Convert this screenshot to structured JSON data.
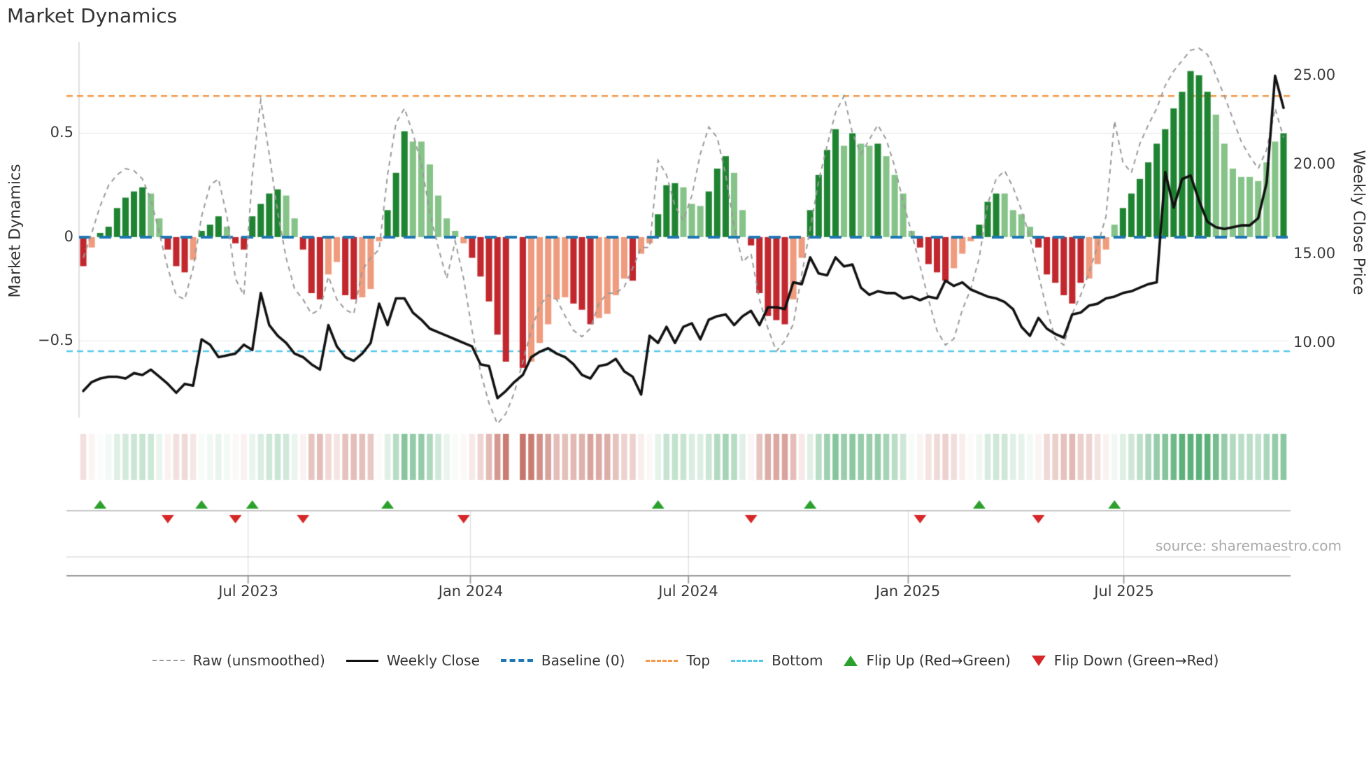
{
  "title": "Market Dynamics",
  "source_note": "source: sharemaestro.com",
  "colors": {
    "bar_positive_strong": "#1f8432",
    "bar_positive_faded": "#86c388",
    "bar_negative_strong": "#c1272d",
    "bar_negative_faded": "#ef9b7d",
    "weekly_close_line": "#111111",
    "raw_line": "#999999",
    "baseline_line": "#1f77b4",
    "top_line": "#f2994a",
    "bottom_line": "#55c8e8",
    "flip_up_marker": "#2ca02c",
    "flip_down_marker": "#d62728",
    "grid": "#e8e8e8",
    "source_text": "#aaaaaa"
  },
  "left_axis": {
    "label": "Market Dynamics",
    "range": [
      -0.87,
      0.94
    ],
    "ticks": [
      {
        "value": 0.5,
        "label": "0.5"
      },
      {
        "value": 0.0,
        "label": "0"
      },
      {
        "value": -0.5,
        "label": "−0.5"
      }
    ]
  },
  "right_axis": {
    "label": "Weekly Close Price",
    "range": [
      5.8,
      26.9
    ],
    "ticks": [
      {
        "value": 25,
        "label": "25.00"
      },
      {
        "value": 20,
        "label": "20.00"
      },
      {
        "value": 15,
        "label": "15.00"
      },
      {
        "value": 10,
        "label": "10.00"
      }
    ]
  },
  "x_axis": {
    "ticks": [
      {
        "week": 19.5,
        "label": "Jul 2023"
      },
      {
        "week": 45.8,
        "label": "Jan 2024"
      },
      {
        "week": 71.6,
        "label": "Jul 2024"
      },
      {
        "week": 97.6,
        "label": "Jan 2025"
      },
      {
        "week": 123.1,
        "label": "Jul 2025"
      }
    ]
  },
  "legend": {
    "items": [
      {
        "key": "raw",
        "label": "Raw (unsmoothed)"
      },
      {
        "key": "close",
        "label": "Weekly Close"
      },
      {
        "key": "baseline",
        "label": "Baseline (0)"
      },
      {
        "key": "top",
        "label": "Top"
      },
      {
        "key": "bottom",
        "label": "Bottom"
      },
      {
        "key": "flip_up",
        "label": "Flip Up (Red→Green)"
      },
      {
        "key": "flip_down",
        "label": "Flip Down (Green→Red)"
      }
    ]
  },
  "chart_data": {
    "type": "combo: weekly bars (market dynamics, left axis) + heatmap strip + flip event markers + lines (weekly close on right axis, raw dashed on left axis)",
    "n_weeks": 143,
    "reference_lines": {
      "baseline": 0.0,
      "top": 0.68,
      "bottom": -0.55
    },
    "bars": {
      "values": [
        -0.14,
        -0.05,
        0.02,
        0.05,
        0.14,
        0.19,
        0.22,
        0.24,
        0.21,
        0.09,
        -0.06,
        -0.14,
        -0.17,
        -0.11,
        0.03,
        0.06,
        0.1,
        0.05,
        -0.03,
        -0.06,
        0.1,
        0.16,
        0.21,
        0.23,
        0.2,
        0.09,
        -0.06,
        -0.27,
        -0.3,
        -0.18,
        -0.12,
        -0.28,
        -0.3,
        -0.29,
        -0.25,
        -0.02,
        0.13,
        0.31,
        0.51,
        0.46,
        0.46,
        0.35,
        0.2,
        0.09,
        0.03,
        -0.03,
        -0.1,
        -0.19,
        -0.31,
        -0.47,
        -0.6,
        0.0,
        -0.63,
        -0.6,
        -0.51,
        -0.42,
        -0.3,
        -0.29,
        -0.32,
        -0.35,
        -0.42,
        -0.39,
        -0.37,
        -0.28,
        -0.2,
        -0.21,
        -0.08,
        -0.03,
        0.11,
        0.25,
        0.26,
        0.24,
        0.16,
        0.15,
        0.22,
        0.33,
        0.39,
        0.31,
        0.13,
        -0.04,
        -0.27,
        -0.38,
        -0.4,
        -0.42,
        -0.3,
        -0.1,
        0.13,
        0.3,
        0.42,
        0.52,
        0.44,
        0.5,
        0.45,
        0.44,
        0.45,
        0.39,
        0.3,
        0.21,
        0.03,
        -0.05,
        -0.13,
        -0.17,
        -0.21,
        -0.15,
        -0.08,
        -0.02,
        0.06,
        0.17,
        0.21,
        0.21,
        0.13,
        0.11,
        0.05,
        -0.05,
        -0.18,
        -0.22,
        -0.28,
        -0.32,
        -0.22,
        -0.2,
        -0.13,
        -0.06,
        0.06,
        0.14,
        0.21,
        0.28,
        0.36,
        0.45,
        0.52,
        0.62,
        0.7,
        0.8,
        0.78,
        0.7,
        0.59,
        0.45,
        0.33,
        0.29,
        0.29,
        0.27,
        0.36,
        0.46,
        0.5
      ],
      "shades": "dlddddddlldddldddldvar_placeholder",
      "shade_string": "dlddddddlldddldddldqddddlldddllddllldddlllllllddddd0dllllldddlllldlldddllldddlldddddllddddldlldllllddddllldddllllddddddlllldddddddddddllllllllddd",
      "shade_legend": "d = strong/dark bar (momentum increasing), l = faded/light bar (momentum fading), 0 = no bar (zero week)"
    },
    "weekly_close": [
      7.3,
      7.8,
      8.0,
      8.1,
      8.1,
      8.0,
      8.3,
      8.2,
      8.5,
      8.1,
      7.7,
      7.2,
      7.7,
      7.6,
      10.2,
      9.9,
      9.2,
      9.3,
      9.4,
      9.9,
      9.6,
      12.8,
      11.0,
      10.4,
      10.0,
      9.4,
      9.2,
      8.8,
      8.5,
      11.0,
      9.8,
      9.2,
      9.0,
      9.4,
      10.0,
      12.2,
      11.0,
      12.5,
      12.5,
      11.7,
      11.3,
      10.8,
      10.6,
      10.4,
      10.2,
      10.0,
      9.8,
      8.8,
      8.7,
      6.9,
      7.3,
      7.8,
      8.2,
      9.2,
      9.5,
      9.7,
      9.4,
      9.2,
      8.8,
      8.2,
      8.0,
      8.7,
      8.8,
      9.1,
      8.4,
      8.1,
      7.1,
      10.4,
      10.0,
      10.9,
      10.0,
      10.9,
      11.1,
      10.2,
      11.3,
      11.5,
      11.6,
      11.0,
      11.5,
      11.8,
      11.0,
      12.0,
      12.0,
      11.9,
      13.4,
      13.3,
      14.8,
      13.9,
      13.8,
      14.8,
      14.3,
      14.4,
      13.1,
      12.7,
      12.9,
      12.8,
      12.8,
      12.5,
      12.6,
      12.4,
      12.6,
      12.5,
      13.5,
      13.2,
      13.4,
      13.0,
      12.8,
      12.6,
      12.5,
      12.3,
      11.9,
      10.9,
      10.4,
      11.4,
      10.8,
      10.5,
      10.3,
      11.6,
      11.7,
      12.1,
      12.2,
      12.5,
      12.6,
      12.8,
      12.9,
      13.1,
      13.3,
      13.4,
      19.6,
      17.6,
      19.2,
      19.4,
      18.0,
      16.8,
      16.5,
      16.4,
      16.5,
      16.6,
      16.6,
      17.0,
      19.0,
      25.0,
      23.2
    ],
    "raw": [
      -0.1,
      0.02,
      0.15,
      0.25,
      0.3,
      0.33,
      0.32,
      0.28,
      0.18,
      0.02,
      -0.15,
      -0.28,
      -0.3,
      -0.15,
      0.1,
      0.25,
      0.28,
      0.1,
      -0.2,
      -0.28,
      0.3,
      0.66,
      0.4,
      0.12,
      -0.1,
      -0.25,
      -0.3,
      -0.37,
      -0.35,
      -0.19,
      -0.3,
      -0.35,
      -0.37,
      -0.16,
      -0.1,
      -0.06,
      0.3,
      0.55,
      0.62,
      0.5,
      0.35,
      0.12,
      -0.05,
      -0.2,
      -0.02,
      -0.2,
      -0.45,
      -0.65,
      -0.8,
      -0.9,
      -0.85,
      -0.75,
      -0.6,
      -0.45,
      -0.33,
      -0.28,
      -0.3,
      -0.38,
      -0.45,
      -0.48,
      -0.44,
      -0.32,
      -0.27,
      -0.27,
      -0.24,
      -0.15,
      -0.05,
      -0.05,
      0.37,
      0.3,
      0.15,
      0.08,
      0.2,
      0.4,
      0.53,
      0.48,
      0.3,
      0.05,
      -0.12,
      -0.08,
      -0.3,
      -0.44,
      -0.55,
      -0.5,
      -0.42,
      -0.18,
      0.04,
      0.27,
      0.44,
      0.6,
      0.68,
      0.5,
      0.4,
      0.47,
      0.54,
      0.47,
      0.34,
      0.17,
      0.02,
      -0.14,
      -0.3,
      -0.45,
      -0.52,
      -0.49,
      -0.35,
      -0.25,
      -0.1,
      0.16,
      0.28,
      0.32,
      0.24,
      0.13,
      0.0,
      -0.18,
      -0.35,
      -0.49,
      -0.52,
      -0.37,
      -0.28,
      -0.17,
      -0.04,
      0.1,
      0.56,
      0.36,
      0.31,
      0.45,
      0.54,
      0.62,
      0.73,
      0.8,
      0.85,
      0.9,
      0.91,
      0.88,
      0.78,
      0.68,
      0.57,
      0.46,
      0.39,
      0.33,
      0.42,
      0.62,
      0.48
    ],
    "flip_up_weeks": [
      2,
      14,
      20,
      36,
      68,
      86,
      106,
      122
    ],
    "flip_down_weeks": [
      10,
      18,
      26,
      45,
      79,
      99,
      113
    ],
    "heatmap": "one cell per week, diverging red→white→green color mapped from bars.values; blank cell at week 51"
  }
}
